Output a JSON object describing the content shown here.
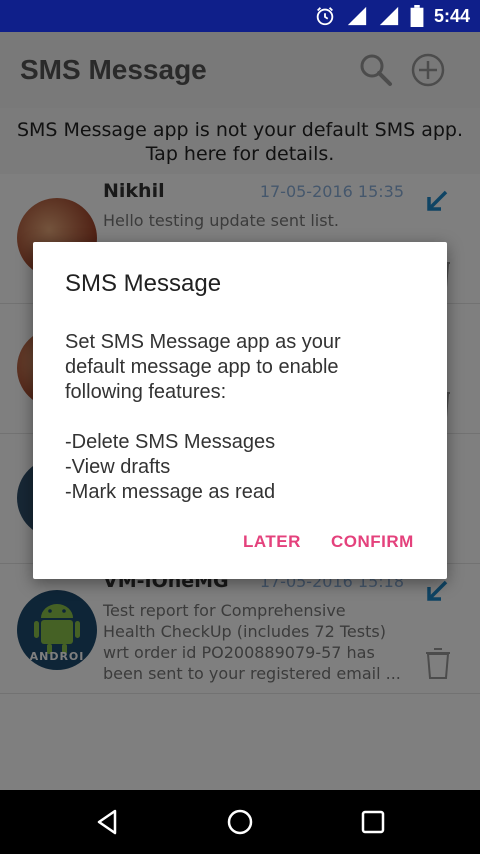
{
  "status_bar": {
    "time": "5:44"
  },
  "header": {
    "title": "SMS Message"
  },
  "banner": {
    "line1": "SMS Message app is not your default SMS app.",
    "line2": "Tap here for details."
  },
  "messages": [
    {
      "name": "Nikhil",
      "date": "17-05-2016 15:35",
      "text": "Hello testing update sent list."
    },
    {
      "name": "",
      "date": "",
      "text": ""
    },
    {
      "name": "",
      "date": "",
      "text": ""
    },
    {
      "name": "VM-IOneMG",
      "date": "17-05-2016 15:18",
      "text": "Test report for Comprehensive Health CheckUp (includes 72 Tests) wrt order id PO200889079-57 has been sent to your registered email ...",
      "avatar_text": "ANDROI"
    }
  ],
  "dialog": {
    "title": "SMS Message",
    "line1": "Set SMS Message app as your",
    "line2": "default message app to enable",
    "line3": "following features:",
    "feature1": "-Delete SMS Messages",
    "feature2": "-View drafts",
    "feature3": "-Mark message as read",
    "later": "LATER",
    "confirm": "CONFIRM"
  },
  "colors": {
    "status_bar": "#0f1f8a",
    "accent": "#e4417c",
    "date": "#8aaed9",
    "arrow": "#1e88c8"
  }
}
